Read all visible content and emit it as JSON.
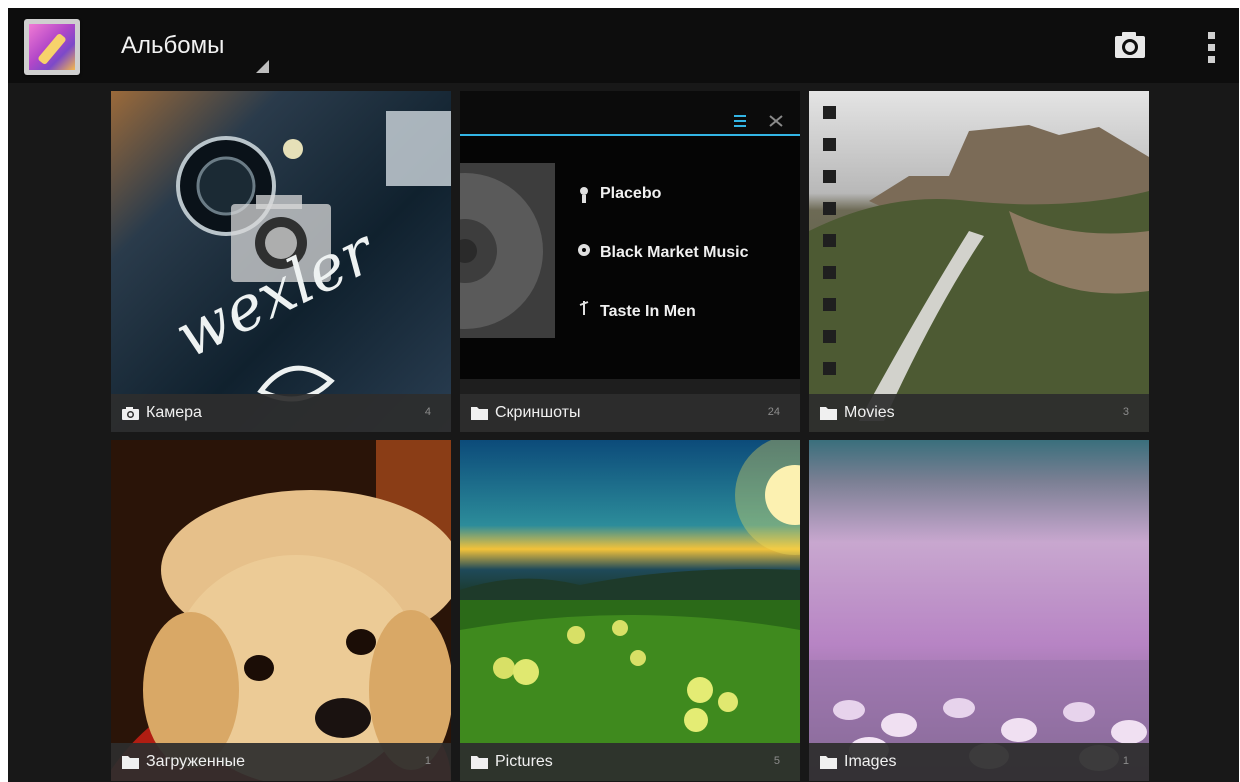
{
  "header": {
    "title": "Альбомы",
    "app_icon": "gallery-app-icon",
    "actions": [
      "camera-icon",
      "overflow-menu-icon"
    ]
  },
  "albums": [
    {
      "name": "Камера",
      "count": "4",
      "icon": "camera-icon"
    },
    {
      "name": "Скриншоты",
      "count": "24",
      "icon": "folder-icon"
    },
    {
      "name": "Movies",
      "count": "3",
      "icon": "folder-icon"
    },
    {
      "name": "Загруженные",
      "count": "1",
      "icon": "folder-icon"
    },
    {
      "name": "Pictures",
      "count": "5",
      "icon": "folder-icon"
    },
    {
      "name": "Images",
      "count": "1",
      "icon": "folder-icon"
    }
  ],
  "screenshot_thumb": {
    "tracks": [
      "Placebo",
      "Black Market Music",
      "Taste In Men"
    ]
  },
  "camera_thumb": {
    "brand_text": "wexler"
  },
  "colors": {
    "background": "#181818",
    "action_bar": "#0d0d0d",
    "label_bar": "#2d2d2d",
    "accent": "#33b5e5"
  }
}
